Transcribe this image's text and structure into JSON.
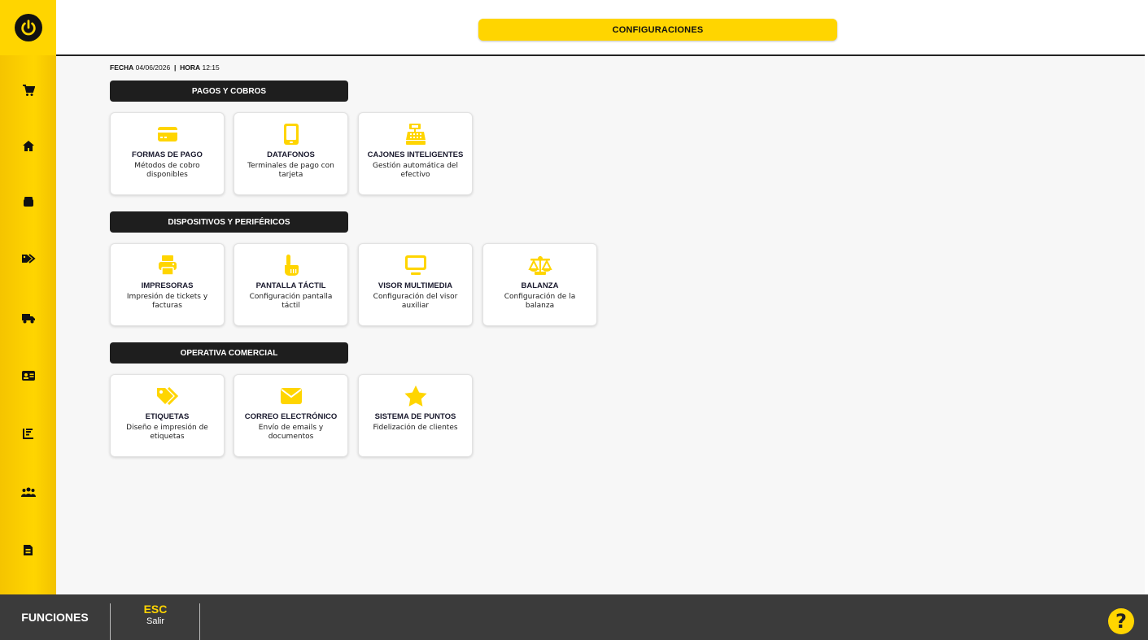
{
  "header": {
    "title": "CONFIGURACIONES"
  },
  "datetime": {
    "date_label": "FECHA",
    "date": "04/06/2026",
    "time_label": "HORA",
    "time": "12:15"
  },
  "sidebar": {
    "items": [
      {
        "icon": "cart-icon"
      },
      {
        "icon": "home-icon"
      },
      {
        "icon": "box-icon"
      },
      {
        "icon": "tags-icon"
      },
      {
        "icon": "truck-icon"
      },
      {
        "icon": "id-card-icon"
      },
      {
        "icon": "chart-icon"
      },
      {
        "icon": "users-icon"
      },
      {
        "icon": "document-icon"
      }
    ]
  },
  "sections": [
    {
      "title": "PAGOS Y COBROS",
      "cards": [
        {
          "icon": "credit-card-icon",
          "title": "FORMAS DE PAGO",
          "desc": "Métodos de cobro disponibles"
        },
        {
          "icon": "tablet-icon",
          "title": "DATAFONOS",
          "desc": "Terminales de pago con tarjeta"
        },
        {
          "icon": "cash-register-icon",
          "title": "CAJONES INTELIGENTES",
          "desc": "Gestión automática del efectivo"
        }
      ]
    },
    {
      "title": "DISPOSITIVOS Y PERIFÉRICOS",
      "cards": [
        {
          "icon": "printer-icon",
          "title": "IMPRESORAS",
          "desc": "Impresión de tickets y facturas"
        },
        {
          "icon": "touch-hand-icon",
          "title": "PANTALLA TÁCTIL",
          "desc": "Configuración pantalla táctil"
        },
        {
          "icon": "monitor-icon",
          "title": "VISOR MULTIMEDIA",
          "desc": "Configuración del visor auxiliar"
        },
        {
          "icon": "scale-icon",
          "title": "BALANZA",
          "desc": "Configuración de la balanza"
        }
      ]
    },
    {
      "title": "OPERATIVA COMERCIAL",
      "cards": [
        {
          "icon": "tags-icon",
          "title": "ETIQUETAS",
          "desc": "Diseño e impresión de etiquetas"
        },
        {
          "icon": "envelope-icon",
          "title": "CORREO ELECTRÓNICO",
          "desc": "Envío de emails y documentos"
        },
        {
          "icon": "star-icon",
          "title": "SISTEMA DE PUNTOS",
          "desc": "Fidelización de clientes"
        }
      ]
    }
  ],
  "footer": {
    "functions_label": "FUNCIONES",
    "esc_key": "ESC",
    "esc_label": "Salir",
    "help_symbol": "?"
  },
  "colors": {
    "accent": "#ffd500",
    "dark": "#1e1e1e",
    "footer": "#3b3b3b"
  }
}
